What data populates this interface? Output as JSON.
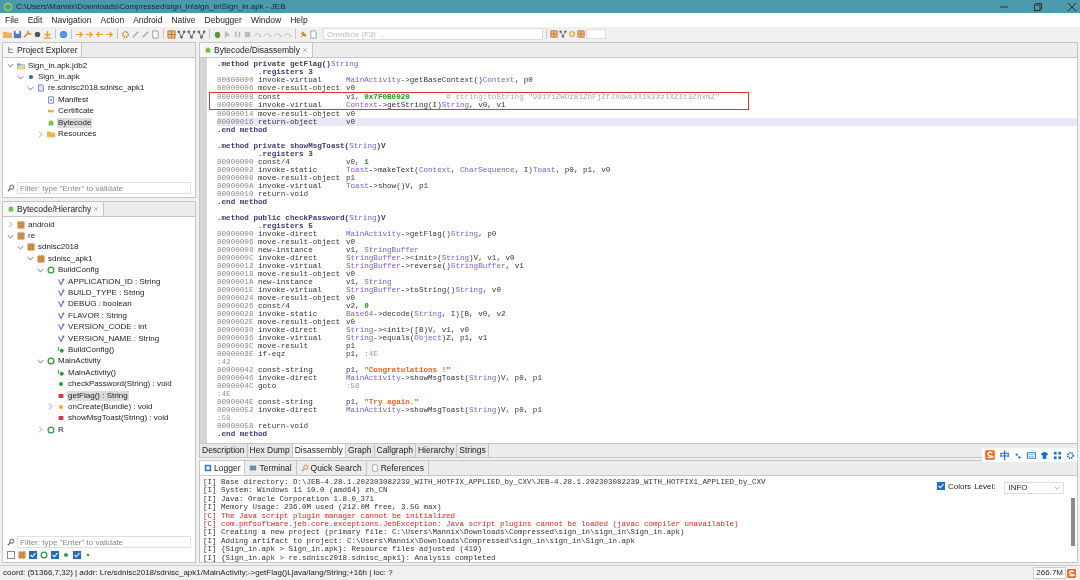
{
  "window": {
    "title": "C:\\Users\\Mannix\\Downloads\\Compressed\\sign_in\\sign_in\\Sign_in.apk - JEB"
  },
  "menu": [
    "File",
    "Edit",
    "Navigation",
    "Action",
    "Android",
    "Native",
    "Debugger",
    "Window",
    "Help"
  ],
  "omnibox": {
    "placeholder": "Omnibox (F3) ..."
  },
  "project_explorer": {
    "tab": "Project Explorer",
    "tree": [
      {
        "label": "Sign_in.apk.jdb2",
        "kind": "project",
        "expanded": true,
        "selected": false,
        "children": [
          {
            "label": "Sign_in.apk",
            "kind": "apk",
            "expanded": true,
            "selected": false,
            "children": [
              {
                "label": "re.sdnisc2018.sdnisc_apk1",
                "kind": "unit",
                "expanded": true,
                "selected": false,
                "children": [
                  {
                    "label": "Manifest",
                    "kind": "manifest",
                    "selected": false
                  },
                  {
                    "label": "Certificate",
                    "kind": "certificate",
                    "selected": false
                  },
                  {
                    "label": "Bytecode",
                    "kind": "bytecode",
                    "selected": true
                  },
                  {
                    "label": "Resources",
                    "kind": "folder",
                    "expanded": false,
                    "selected": false
                  }
                ]
              }
            ]
          }
        ]
      }
    ],
    "filter": {
      "placeholder": "Filter: type \"Enter\" to validate"
    }
  },
  "hierarchy": {
    "tab": "Bytecode/Hierarchy",
    "tree": [
      {
        "label": "android",
        "kind": "package",
        "expanded": false,
        "selected": false
      },
      {
        "label": "re",
        "kind": "package",
        "expanded": true,
        "selected": false,
        "children": [
          {
            "label": "sdnisc2018",
            "kind": "package",
            "expanded": true,
            "selected": false,
            "children": [
              {
                "label": "sdnisc_apk1",
                "kind": "package",
                "expanded": true,
                "selected": false,
                "children": [
                  {
                    "label": "BuildConfig",
                    "kind": "class",
                    "expanded": true,
                    "selected": false,
                    "children": [
                      {
                        "label": "APPLICATION_ID : String",
                        "kind": "field",
                        "selected": false
                      },
                      {
                        "label": "BUILD_TYPE : String",
                        "kind": "field",
                        "selected": false
                      },
                      {
                        "label": "DEBUG : boolean",
                        "kind": "field",
                        "selected": false
                      },
                      {
                        "label": "FLAVOR : String",
                        "kind": "field",
                        "selected": false
                      },
                      {
                        "label": "VERSION_CODE : int",
                        "kind": "field",
                        "selected": false
                      },
                      {
                        "label": "VERSION_NAME : String",
                        "kind": "field",
                        "selected": false
                      },
                      {
                        "label": "BuildConfig()",
                        "kind": "constructor",
                        "selected": false
                      }
                    ]
                  },
                  {
                    "label": "MainActivity",
                    "kind": "class",
                    "expanded": true,
                    "selected": false,
                    "children": [
                      {
                        "label": "MainActivity()",
                        "kind": "constructor",
                        "selected": false
                      },
                      {
                        "label": "checkPassword(String) : void",
                        "kind": "public",
                        "selected": false
                      },
                      {
                        "label": "getFlag() : String",
                        "kind": "private",
                        "selected": true
                      },
                      {
                        "label": "onCreate(Bundle) : void",
                        "kind": "protected",
                        "expanded": false,
                        "selected": false
                      },
                      {
                        "label": "showMsgToast(String) : void",
                        "kind": "private",
                        "selected": false
                      }
                    ]
                  },
                  {
                    "label": "R",
                    "kind": "class",
                    "expanded": false,
                    "selected": false
                  }
                ]
              }
            ]
          }
        ]
      }
    ],
    "filter": {
      "placeholder": "Filter: type \"Enter\" to validate"
    },
    "filter_options": [
      {
        "kind": "package",
        "checked": false
      },
      {
        "kind": "class",
        "checked": true
      },
      {
        "kind": "public",
        "checked": true
      },
      {
        "kind": "small",
        "checked": true
      }
    ]
  },
  "editor": {
    "tab": "Bytecode/Disassembly",
    "lines": [
      {
        "kind": "method",
        "parts": [
          {
            "t": ".method private getFlag()",
            "kind": "dir"
          },
          {
            "t": "String",
            "kind": "type"
          }
        ]
      },
      {
        "kind": "registers",
        "parts": [
          {
            "t": ".registers 3",
            "kind": "dir"
          }
        ]
      },
      {
        "kind": "instr",
        "addr": "00000000",
        "op": "invoke-virtual",
        "args": [
          {
            "t": "MainActivity",
            "kind": "type"
          },
          {
            "t": "->getBaseContext()",
            "kind": "plain"
          },
          {
            "t": "Context",
            "kind": "type"
          },
          {
            "t": ", p0",
            "kind": "plain"
          }
        ]
      },
      {
        "kind": "instr",
        "addr": "00000006",
        "op": "move-result-object",
        "args": [
          {
            "t": "v0",
            "kind": "plain"
          }
        ]
      },
      {
        "kind": "instr",
        "addr": "00000008",
        "op": "const",
        "boxed": true,
        "args": [
          {
            "t": "v1, ",
            "kind": "plain"
          },
          {
            "t": "0x7F0B0020",
            "kind": "num"
          },
          {
            "t": "        # string:toString \"991YiZWOz81ZhFjZfJXdwk3X1k2XzIXZIt3ZhxmZ\"",
            "kind": "comment"
          }
        ]
      },
      {
        "kind": "instr",
        "addr": "0000000E",
        "op": "invoke-virtual",
        "boxed": true,
        "args": [
          {
            "t": "Context",
            "kind": "type"
          },
          {
            "t": "->getString(I)",
            "kind": "plain"
          },
          {
            "t": "String",
            "kind": "type"
          },
          {
            "t": ", v0, v1",
            "kind": "plain"
          }
        ]
      },
      {
        "kind": "instr",
        "addr": "00000014",
        "op": "move-result-object",
        "args": [
          {
            "t": "v0",
            "kind": "plain"
          }
        ]
      },
      {
        "kind": "instr",
        "addr": "00000016",
        "op": "return-object",
        "current": true,
        "args": [
          {
            "t": "v0",
            "kind": "plain"
          }
        ]
      },
      {
        "kind": "end",
        "parts": [
          {
            "t": ".end method",
            "kind": "dir"
          }
        ]
      },
      {
        "kind": "blank"
      },
      {
        "kind": "method",
        "parts": [
          {
            "t": ".method private showMsgToast(",
            "kind": "dir"
          },
          {
            "t": "String",
            "kind": "type"
          },
          {
            "t": ")V",
            "kind": "dir"
          }
        ]
      },
      {
        "kind": "registers",
        "parts": [
          {
            "t": ".registers 3",
            "kind": "dir"
          }
        ]
      },
      {
        "kind": "instr",
        "addr": "00000000",
        "op": "const/4",
        "args": [
          {
            "t": "v0, ",
            "kind": "plain"
          },
          {
            "t": "1",
            "kind": "num"
          }
        ]
      },
      {
        "kind": "instr",
        "addr": "00000002",
        "op": "invoke-static",
        "args": [
          {
            "t": "Toast",
            "kind": "type"
          },
          {
            "t": "->makeText(",
            "kind": "plain"
          },
          {
            "t": "Context",
            "kind": "type"
          },
          {
            "t": ", ",
            "kind": "plain"
          },
          {
            "t": "CharSequence",
            "kind": "type"
          },
          {
            "t": ", I)",
            "kind": "plain"
          },
          {
            "t": "Toast",
            "kind": "type"
          },
          {
            "t": ", p0, p1, v0",
            "kind": "plain"
          }
        ]
      },
      {
        "kind": "instr",
        "addr": "00000008",
        "op": "move-result-object",
        "args": [
          {
            "t": "p1",
            "kind": "plain"
          }
        ]
      },
      {
        "kind": "instr",
        "addr": "0000000A",
        "op": "invoke-virtual",
        "args": [
          {
            "t": "Toast",
            "kind": "type"
          },
          {
            "t": "->show()V, p1",
            "kind": "plain"
          }
        ]
      },
      {
        "kind": "instr",
        "addr": "00000010",
        "op": "return-void"
      },
      {
        "kind": "end",
        "parts": [
          {
            "t": ".end method",
            "kind": "dir"
          }
        ]
      },
      {
        "kind": "blank"
      },
      {
        "kind": "method",
        "parts": [
          {
            "t": ".method public checkPassword(",
            "kind": "dir"
          },
          {
            "t": "String",
            "kind": "type"
          },
          {
            "t": ")V",
            "kind": "dir"
          }
        ]
      },
      {
        "kind": "registers",
        "parts": [
          {
            "t": ".registers 5",
            "kind": "dir"
          }
        ]
      },
      {
        "kind": "instr",
        "addr": "00000000",
        "op": "invoke-direct",
        "args": [
          {
            "t": "MainActivity",
            "kind": "type"
          },
          {
            "t": "->getFlag()",
            "kind": "plain"
          },
          {
            "t": "String",
            "kind": "type"
          },
          {
            "t": ", p0",
            "kind": "plain"
          }
        ]
      },
      {
        "kind": "instr",
        "addr": "00000006",
        "op": "move-result-object",
        "args": [
          {
            "t": "v0",
            "kind": "plain"
          }
        ]
      },
      {
        "kind": "instr",
        "addr": "00000008",
        "op": "new-instance",
        "args": [
          {
            "t": "v1, ",
            "kind": "plain"
          },
          {
            "t": "StringBuffer",
            "kind": "type"
          }
        ]
      },
      {
        "kind": "instr",
        "addr": "0000000C",
        "op": "invoke-direct",
        "args": [
          {
            "t": "StringBuffer",
            "kind": "type"
          },
          {
            "t": "-><init>(",
            "kind": "plain"
          },
          {
            "t": "String",
            "kind": "type"
          },
          {
            "t": ")V, v1, v0",
            "kind": "plain"
          }
        ]
      },
      {
        "kind": "instr",
        "addr": "00000012",
        "op": "invoke-virtual",
        "args": [
          {
            "t": "StringBuffer",
            "kind": "type"
          },
          {
            "t": "->reverse()",
            "kind": "plain"
          },
          {
            "t": "StringBuffer",
            "kind": "type"
          },
          {
            "t": ", v1",
            "kind": "plain"
          }
        ]
      },
      {
        "kind": "instr",
        "addr": "00000018",
        "op": "move-result-object",
        "args": [
          {
            "t": "v0",
            "kind": "plain"
          }
        ]
      },
      {
        "kind": "instr",
        "addr": "0000001A",
        "op": "new-instance",
        "args": [
          {
            "t": "v1, ",
            "kind": "plain"
          },
          {
            "t": "String",
            "kind": "type"
          }
        ]
      },
      {
        "kind": "instr",
        "addr": "0000001E",
        "op": "invoke-virtual",
        "args": [
          {
            "t": "StringBuffer",
            "kind": "type"
          },
          {
            "t": "->toString()",
            "kind": "plain"
          },
          {
            "t": "String",
            "kind": "type"
          },
          {
            "t": ", v0",
            "kind": "plain"
          }
        ]
      },
      {
        "kind": "instr",
        "addr": "00000024",
        "op": "move-result-object",
        "args": [
          {
            "t": "v0",
            "kind": "plain"
          }
        ]
      },
      {
        "kind": "instr",
        "addr": "00000026",
        "op": "const/4",
        "args": [
          {
            "t": "v2, ",
            "kind": "plain"
          },
          {
            "t": "0",
            "kind": "num"
          }
        ]
      },
      {
        "kind": "instr",
        "addr": "00000028",
        "op": "invoke-static",
        "args": [
          {
            "t": "Base64",
            "kind": "type"
          },
          {
            "t": "->decode(",
            "kind": "plain"
          },
          {
            "t": "String",
            "kind": "type"
          },
          {
            "t": ", I)[B, v0, v2",
            "kind": "plain"
          }
        ]
      },
      {
        "kind": "instr",
        "addr": "0000002E",
        "op": "move-result-object",
        "args": [
          {
            "t": "v0",
            "kind": "plain"
          }
        ]
      },
      {
        "kind": "instr",
        "addr": "00000030",
        "op": "invoke-direct",
        "args": [
          {
            "t": "String",
            "kind": "type"
          },
          {
            "t": "-><init>([B)V, v1, v0",
            "kind": "plain"
          }
        ]
      },
      {
        "kind": "instr",
        "addr": "00000036",
        "op": "invoke-virtual",
        "args": [
          {
            "t": "String",
            "kind": "type"
          },
          {
            "t": "->equals(",
            "kind": "plain"
          },
          {
            "t": "Object",
            "kind": "type"
          },
          {
            "t": ")Z, p1, v1",
            "kind": "plain"
          }
        ]
      },
      {
        "kind": "instr",
        "addr": "0000003C",
        "op": "move-result",
        "args": [
          {
            "t": "p1",
            "kind": "plain"
          }
        ]
      },
      {
        "kind": "instr",
        "addr": "0000003E",
        "op": "if-eqz",
        "args": [
          {
            "t": "p1, ",
            "kind": "plain"
          },
          {
            "t": ":4E",
            "kind": "label"
          }
        ]
      },
      {
        "kind": "label",
        "parts": [
          {
            "t": ":42",
            "kind": "label"
          }
        ]
      },
      {
        "kind": "instr",
        "addr": "00000042",
        "op": "const-string",
        "args": [
          {
            "t": "p1, ",
            "kind": "plain"
          },
          {
            "t": "\"Congratulations !\"",
            "kind": "str"
          }
        ]
      },
      {
        "kind": "instr",
        "addr": "00000046",
        "op": "invoke-direct",
        "args": [
          {
            "t": "MainActivity",
            "kind": "type"
          },
          {
            "t": "->showMsgToast(",
            "kind": "plain"
          },
          {
            "t": "String",
            "kind": "type"
          },
          {
            "t": ")V, p0, p1",
            "kind": "plain"
          }
        ]
      },
      {
        "kind": "instr",
        "addr": "0000004C",
        "op": "goto",
        "args": [
          {
            "t": ":58",
            "kind": "label"
          }
        ]
      },
      {
        "kind": "label",
        "parts": [
          {
            "t": ":4E",
            "kind": "label"
          }
        ]
      },
      {
        "kind": "instr",
        "addr": "0000004E",
        "op": "const-string",
        "args": [
          {
            "t": "p1, ",
            "kind": "plain"
          },
          {
            "t": "\"Try again.\"",
            "kind": "str"
          }
        ]
      },
      {
        "kind": "instr",
        "addr": "00000052",
        "op": "invoke-direct",
        "args": [
          {
            "t": "MainActivity",
            "kind": "type"
          },
          {
            "t": "->showMsgToast(",
            "kind": "plain"
          },
          {
            "t": "String",
            "kind": "type"
          },
          {
            "t": ")V, p0, p1",
            "kind": "plain"
          }
        ]
      },
      {
        "kind": "label",
        "parts": [
          {
            "t": ":58",
            "kind": "label"
          }
        ]
      },
      {
        "kind": "instr",
        "addr": "00000058",
        "op": "return-void"
      },
      {
        "kind": "end",
        "parts": [
          {
            "t": ".end method",
            "kind": "dir"
          }
        ]
      }
    ],
    "bottom_tabs": [
      {
        "label": "Description",
        "selected": false
      },
      {
        "label": "Hex Dump",
        "selected": false
      },
      {
        "label": "Disassembly",
        "selected": true
      },
      {
        "label": "Graph",
        "selected": false
      },
      {
        "label": "Callgraph",
        "selected": false
      },
      {
        "label": "Hierarchy",
        "selected": false
      },
      {
        "label": "Strings",
        "selected": false
      }
    ]
  },
  "logger": {
    "tabs": [
      {
        "label": "Logger",
        "selected": true
      },
      {
        "label": "Terminal",
        "selected": false
      },
      {
        "label": "Quick Search",
        "selected": false
      },
      {
        "label": "References",
        "selected": false
      }
    ],
    "lines": [
      {
        "kind": "info",
        "text": "[I] Base directory: D:\\JEB-4.28.1.202303082239_WITH_HOTFIX_APPLIED_by_CXV\\JEB-4.28.1.202303082239_WITH_HOTFIX1_APPLIED_by_CXV"
      },
      {
        "kind": "info",
        "text": "[I] System: Windows 11 10.0 (amd64) zh_CN"
      },
      {
        "kind": "info",
        "text": "[I] Java: Oracle Corporation 1.8.0_371"
      },
      {
        "kind": "info",
        "text": "[I] Memory Usage: 236.0M used (212.0M free, 3.5G max)"
      },
      {
        "kind": "critical",
        "text": "[C] The Java script plugin manager cannot be initialized"
      },
      {
        "kind": "critical",
        "text": "[C] com.pnfsoftware.jeb.core.exceptions.JebException: Java script plugins cannot be loaded (javac compiler unavailable)"
      },
      {
        "kind": "info",
        "text": "[I] Creating a new project (primary file: C:\\Users\\Mannix\\Downloads\\Compressed\\sign_in\\sign_in\\Sign_in.apk)"
      },
      {
        "kind": "info",
        "text": "[I] Adding artifact to project: C:\\Users\\Mannix\\Downloads\\Compressed\\sign_in\\sign_in\\Sign_in.apk"
      },
      {
        "kind": "info",
        "text": "[I] {Sign_in.apk > Sign_in.apk}: Resource files adjusted (419)"
      },
      {
        "kind": "info",
        "text": "[I] {Sign_in.apk > re.sdnisc2018.sdnisc_apk1}: Analysis completed"
      }
    ],
    "colors": {
      "label": "Colors",
      "checked": true
    },
    "level": {
      "label": "Level:",
      "value": "INFO"
    }
  },
  "ime": {
    "text": "中"
  },
  "status_bar": {
    "text": "coord: (51366,7,32) | addr: Lre/sdnisc2018/sdnisc_apk1/MainActivity;->getFlag()Ljava/lang/String;+16h | loc: ?",
    "memory": "266.7M"
  }
}
